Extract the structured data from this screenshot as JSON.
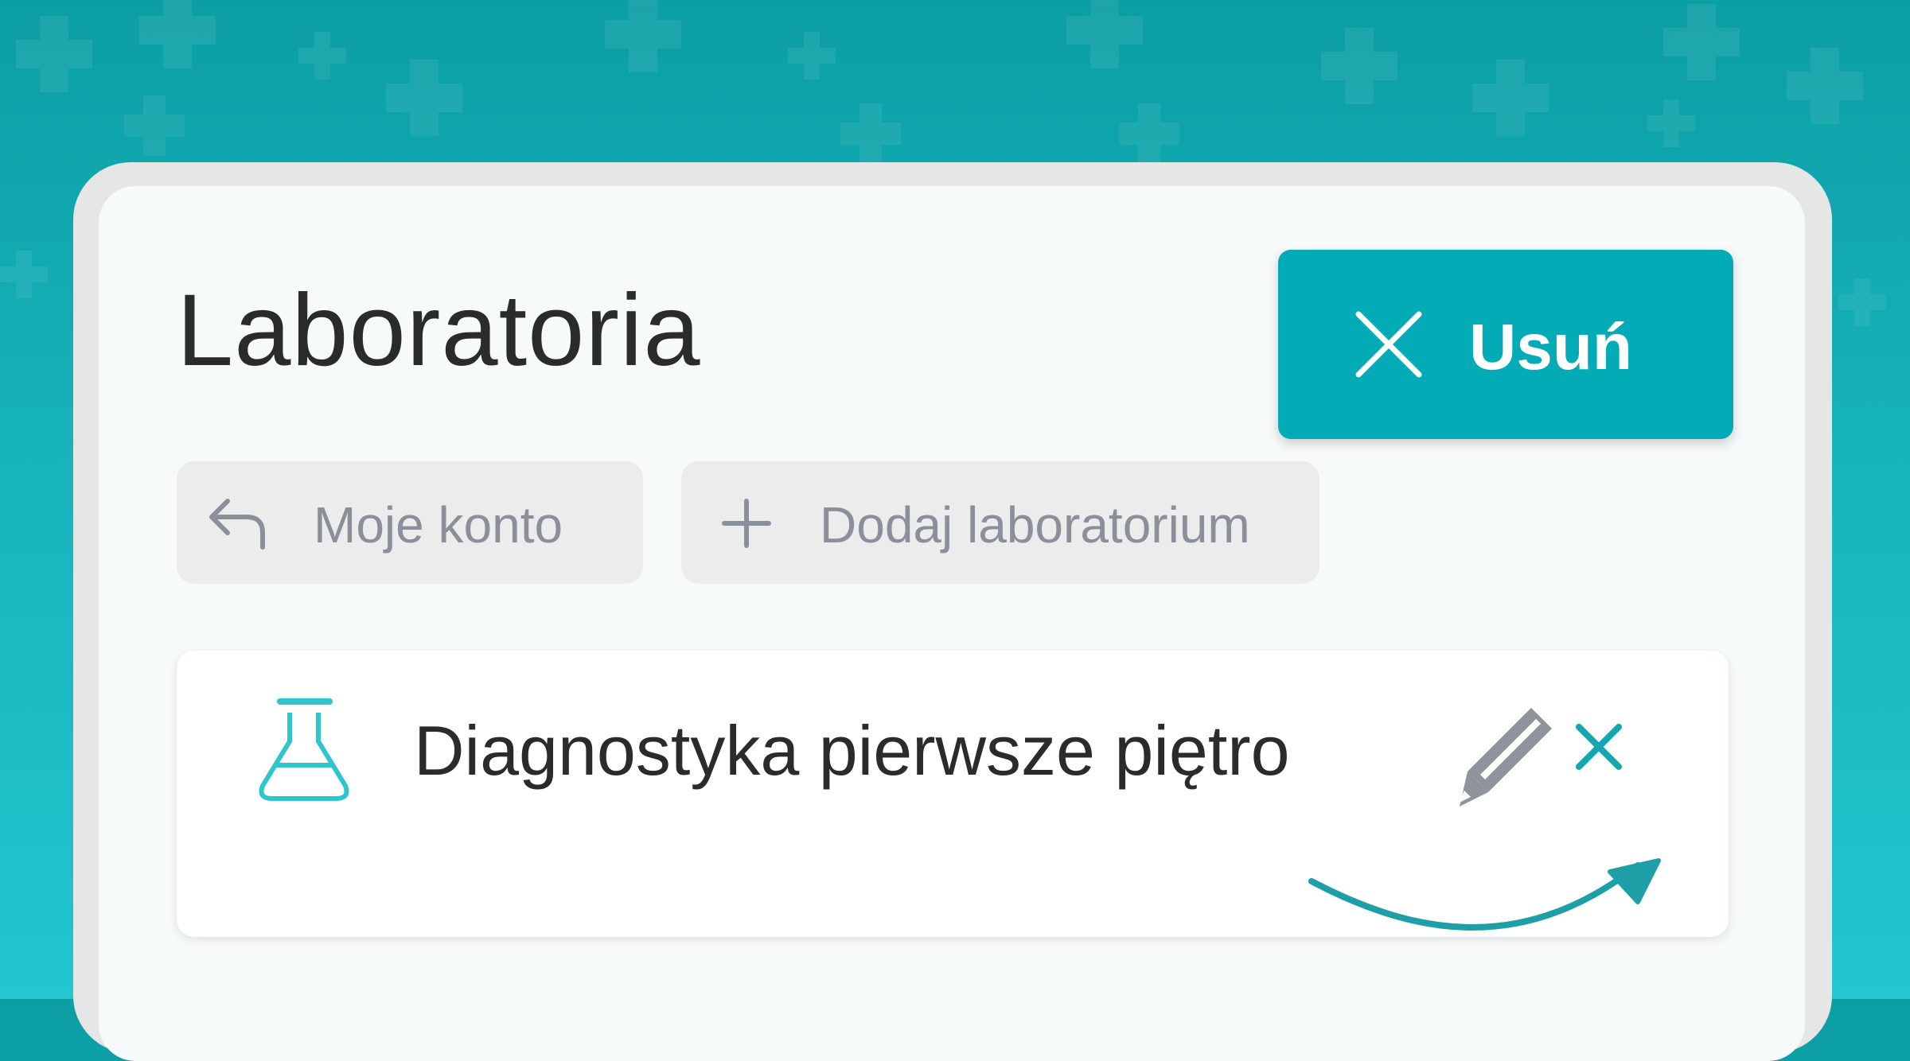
{
  "header": {
    "title": "Laboratoria"
  },
  "actions": {
    "delete_label": "Usuń"
  },
  "nav": {
    "back_label": "Moje konto",
    "add_label": "Dodaj laboratorium"
  },
  "labs": [
    {
      "name": "Diagnostyka pierwsze piętro",
      "icon": "flask-icon"
    }
  ],
  "colors": {
    "accent": "#03abb6",
    "background_top": "#0b9ea4",
    "background_bottom": "#22c7cf",
    "text_primary": "#2b2b2b",
    "text_muted": "#8a8f99",
    "chip_background": "#ececec",
    "flask_icon": "#2ec5cd",
    "edit_icon": "#8f939b",
    "remove_icon": "#14a7b1",
    "arrow": "#1e9ea6"
  },
  "icons": {
    "delete": "close-icon",
    "back": "reply-arrow-icon",
    "add": "plus-icon",
    "edit": "pencil-icon",
    "remove": "close-icon",
    "hint": "curved-arrow-icon"
  }
}
